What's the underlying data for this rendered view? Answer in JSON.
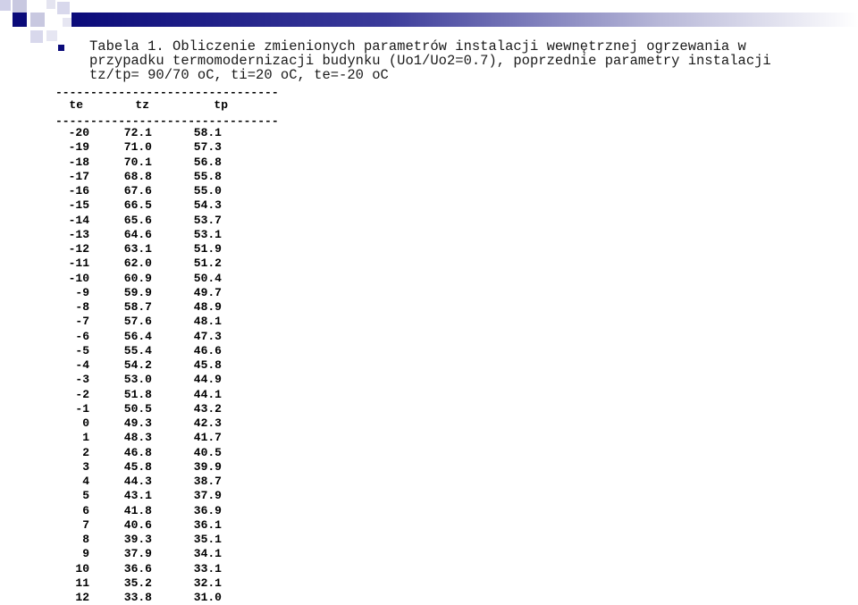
{
  "caption": "Tabela 1. Obliczenie zmienionych parametrów instalacji wewnętrznej ogrzewania w\nprzypadku termomodernizacji budynku (Uo1/Uo2=0.7), poprzednie parametry instalacji\ntz/tp= 90/70 oC, ti=20 oC, te=-20 oC",
  "separator": "--------------------------------",
  "columns": [
    "te",
    "tz",
    "tp"
  ],
  "rows": [
    [
      "-20",
      "72.1",
      "58.1"
    ],
    [
      "-19",
      "71.0",
      "57.3"
    ],
    [
      "-18",
      "70.1",
      "56.8"
    ],
    [
      "-17",
      "68.8",
      "55.8"
    ],
    [
      "-16",
      "67.6",
      "55.0"
    ],
    [
      "-15",
      "66.5",
      "54.3"
    ],
    [
      "-14",
      "65.6",
      "53.7"
    ],
    [
      "-13",
      "64.6",
      "53.1"
    ],
    [
      "-12",
      "63.1",
      "51.9"
    ],
    [
      "-11",
      "62.0",
      "51.2"
    ],
    [
      "-10",
      "60.9",
      "50.4"
    ],
    [
      "-9",
      "59.9",
      "49.7"
    ],
    [
      "-8",
      "58.7",
      "48.9"
    ],
    [
      "-7",
      "57.6",
      "48.1"
    ],
    [
      "-6",
      "56.4",
      "47.3"
    ],
    [
      "-5",
      "55.4",
      "46.6"
    ],
    [
      "-4",
      "54.2",
      "45.8"
    ],
    [
      "-3",
      "53.0",
      "44.9"
    ],
    [
      "-2",
      "51.8",
      "44.1"
    ],
    [
      "-1",
      "50.5",
      "43.2"
    ],
    [
      "0",
      "49.3",
      "42.3"
    ],
    [
      "1",
      "48.3",
      "41.7"
    ],
    [
      "2",
      "46.8",
      "40.5"
    ],
    [
      "3",
      "45.8",
      "39.9"
    ],
    [
      "4",
      "44.3",
      "38.7"
    ],
    [
      "5",
      "43.1",
      "37.9"
    ],
    [
      "6",
      "41.8",
      "36.9"
    ],
    [
      "7",
      "40.6",
      "36.1"
    ],
    [
      "8",
      "39.3",
      "35.1"
    ],
    [
      "9",
      "37.9",
      "34.1"
    ],
    [
      "10",
      "36.6",
      "33.1"
    ],
    [
      "11",
      "35.2",
      "32.1"
    ],
    [
      "12",
      "33.8",
      "31.0"
    ]
  ]
}
